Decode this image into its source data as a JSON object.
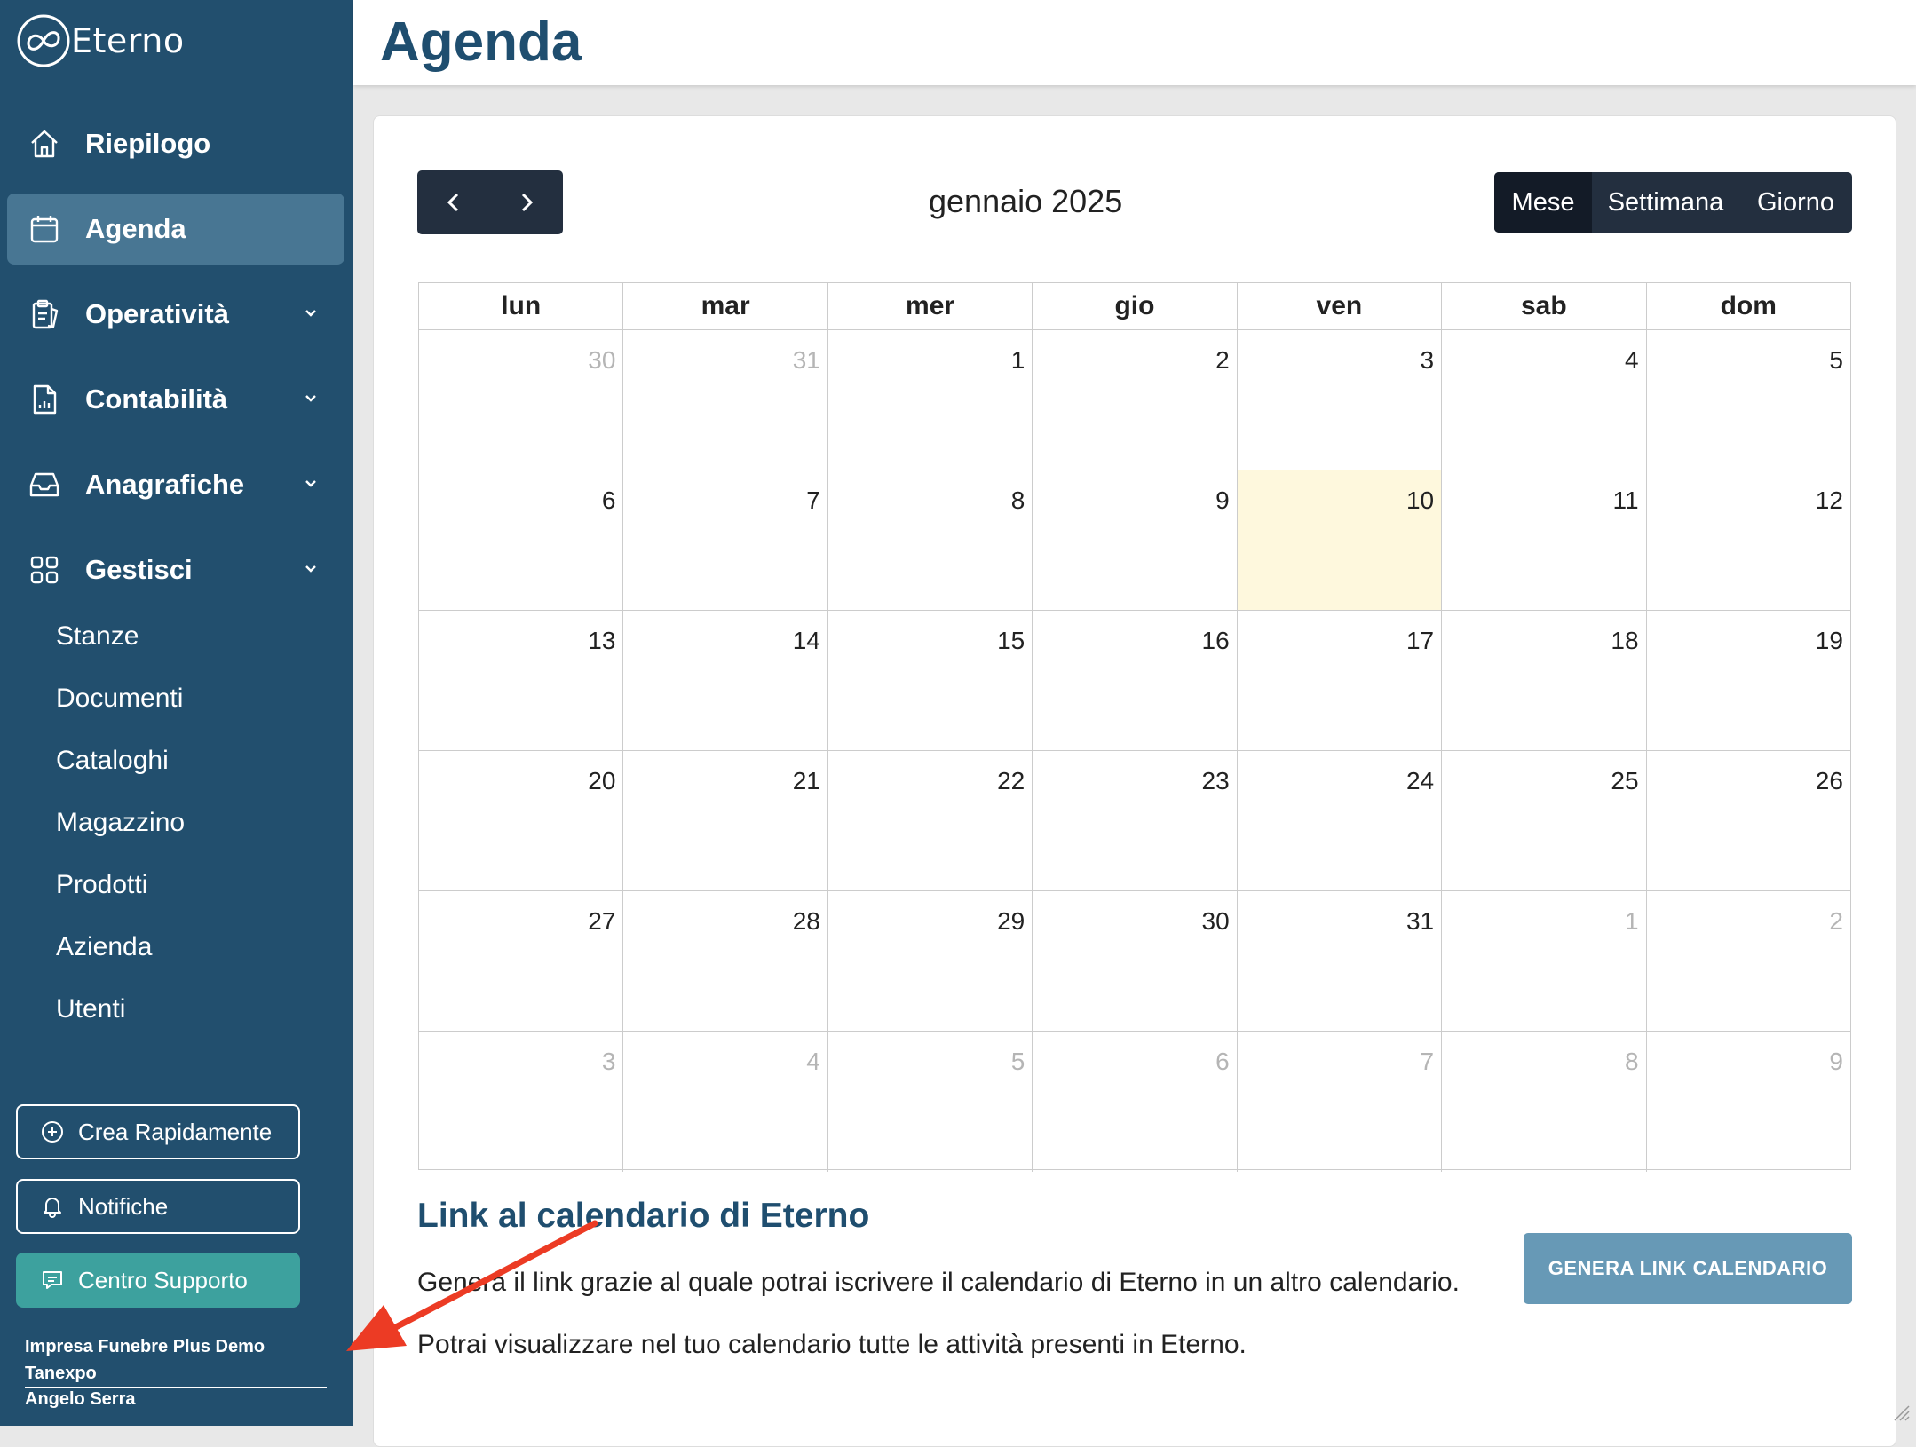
{
  "app": {
    "logo_text": "Eterno"
  },
  "header": {
    "title": "Agenda"
  },
  "sidebar": {
    "items": [
      {
        "label": "Riepilogo",
        "icon": "home-icon"
      },
      {
        "label": "Agenda",
        "icon": "calendar-icon",
        "active": true
      },
      {
        "label": "Operatività",
        "icon": "clipboard-icon",
        "expandable": true
      },
      {
        "label": "Contabilità",
        "icon": "report-icon",
        "expandable": true
      },
      {
        "label": "Anagrafiche",
        "icon": "inbox-icon",
        "expandable": true
      },
      {
        "label": "Gestisci",
        "icon": "grid-icon",
        "expandable": true
      }
    ],
    "sub_items": [
      "Stanze",
      "Documenti",
      "Cataloghi",
      "Magazzino",
      "Prodotti",
      "Azienda",
      "Utenti"
    ],
    "buttons": {
      "quick_create": "Crea Rapidamente",
      "notifications": "Notifiche",
      "support": "Centro Supporto"
    },
    "company": "Impresa Funebre Plus Demo Tanexpo",
    "user": "Angelo Serra"
  },
  "calendar": {
    "month_title": "gennaio 2025",
    "views": [
      "Mese",
      "Settimana",
      "Giorno"
    ],
    "active_view": "Mese",
    "weekdays": [
      "lun",
      "mar",
      "mer",
      "gio",
      "ven",
      "sab",
      "dom"
    ],
    "weeks": [
      [
        "30",
        "31",
        "1",
        "2",
        "3",
        "4",
        "5"
      ],
      [
        "6",
        "7",
        "8",
        "9",
        "10",
        "11",
        "12"
      ],
      [
        "13",
        "14",
        "15",
        "16",
        "17",
        "18",
        "19"
      ],
      [
        "20",
        "21",
        "22",
        "23",
        "24",
        "25",
        "26"
      ],
      [
        "27",
        "28",
        "29",
        "30",
        "31",
        "1",
        "2"
      ],
      [
        "3",
        "4",
        "5",
        "6",
        "7",
        "8",
        "9"
      ]
    ],
    "today": "10"
  },
  "link_section": {
    "title": "Link al calendario di Eterno",
    "p1": "Genera il link grazie al quale potrai iscrivere il calendario di Eterno in un altro calendario.",
    "p2": "Potrai visualizzare nel tuo calendario tutte le attività presenti in Eterno.",
    "button": "GENERA LINK CALENDARIO"
  },
  "colors": {
    "sidebar_bg": "#224f6e",
    "active_item": "#487693",
    "title_blue": "#1f4e6f",
    "today_bg": "#fef8dd",
    "support_teal": "#3da19e",
    "generate_btn": "#6799b6",
    "annotation_arrow": "#ec3b24"
  }
}
